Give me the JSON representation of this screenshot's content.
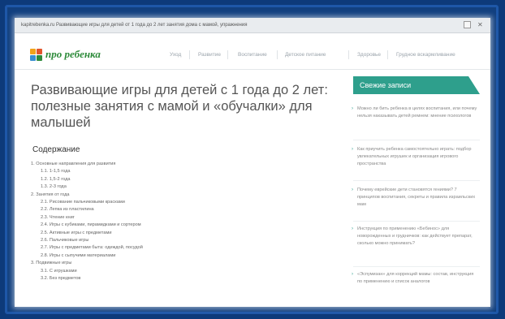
{
  "browser": {
    "title": "kapitrebenka.ru Развивающие игры для детей от 1 года до 2 лет занятия дома с мамой, упражнения"
  },
  "site": {
    "brand": "про ребенка",
    "logo_colors": [
      "#f2a21a",
      "#e2552c",
      "#3a8fd1",
      "#2e8b3b"
    ],
    "nav": [
      "Уход",
      "Развитие",
      "Воспитание",
      "Детское питание",
      "Здоровье",
      "Грудное вскармливание"
    ]
  },
  "article": {
    "title": "Развивающие игры для детей с 1 года до 2 лет: полезные занятия с мамой и «обучалки» для малышей",
    "toc_heading": "Содержание",
    "toc": [
      {
        "text": "1. Основные направления для развития",
        "level": 0
      },
      {
        "text": "1.1. 1-1,5 года",
        "level": 1
      },
      {
        "text": "1.2. 1,5-2 года",
        "level": 1
      },
      {
        "text": "1.3. 2-3 года",
        "level": 1
      },
      {
        "text": "2. Занятия от года",
        "level": 0
      },
      {
        "text": "2.1. Рисование пальчиковыми красками",
        "level": 1
      },
      {
        "text": "2.2. Лепка из пластилина",
        "level": 1
      },
      {
        "text": "2.3. Чтение книг",
        "level": 1
      },
      {
        "text": "2.4. Игры с кубиками, пирамидками и сортером",
        "level": 1
      },
      {
        "text": "2.5. Активные игры с предметами",
        "level": 1
      },
      {
        "text": "2.6. Пальчиковые игры",
        "level": 1
      },
      {
        "text": "2.7. Игры с предметами быта: одеждой, посудой",
        "level": 1
      },
      {
        "text": "2.8. Игры с сыпучими материалами",
        "level": 1
      },
      {
        "text": "3. Подвижные игры",
        "level": 0
      },
      {
        "text": "3.1. С игрушками",
        "level": 1
      },
      {
        "text": "3.2. Без предметов",
        "level": 1
      }
    ]
  },
  "sidebar": {
    "heading": "Свежие записи",
    "accent": "#2e9f8c",
    "posts": [
      "Можно ли бить ребенка в целях воспитания, или почему нельзя наказывать детей ремнем: мнение психологов",
      "Как приучить ребенка самостоятельно играть: подбор увлекательных игрушек и организация игрового пространства",
      "Почему еврейские дети становятся гениями? 7 принципов воспитания, секреты и правила израильских мам",
      "Инструкция по применению «Бебинос» для новорожденных и грудничков: как действует препарат, сколько можно принимать?",
      "«Эспумизан» для коррекций мамы: состав, инструкция по применению и список аналогов"
    ]
  }
}
